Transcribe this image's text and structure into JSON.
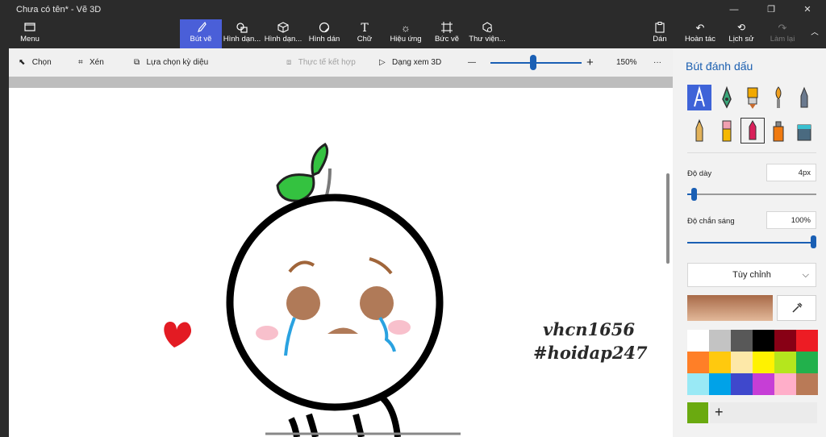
{
  "window": {
    "title": "Chưa có tên* - Vẽ 3D"
  },
  "ribbon": {
    "menu_label": "Menu",
    "tools": [
      {
        "label": "Bút vẽ",
        "icon": "brush-icon",
        "active": true
      },
      {
        "label": "Hình dạn...",
        "icon": "shapes-2d-icon"
      },
      {
        "label": "Hình dạn...",
        "icon": "shapes-3d-icon"
      },
      {
        "label": "Hình dán",
        "icon": "sticker-icon"
      },
      {
        "label": "Chữ",
        "icon": "text-icon"
      },
      {
        "label": "Hiệu ứng",
        "icon": "effects-icon"
      },
      {
        "label": "Bức vẽ",
        "icon": "canvas-icon"
      },
      {
        "label": "Thư viện...",
        "icon": "library-icon"
      }
    ],
    "right_tools": [
      {
        "label": "Dán",
        "icon": "paste-icon"
      },
      {
        "label": "Hoàn tác",
        "icon": "undo-icon"
      },
      {
        "label": "Lịch sử",
        "icon": "history-icon"
      },
      {
        "label": "Làm lại",
        "icon": "redo-icon",
        "disabled": true
      }
    ]
  },
  "subbar": {
    "select": "Chọn",
    "crop": "Xén",
    "magic_select": "Lựa chọn kỳ diệu",
    "mixed_reality": "Thực tế kết hợp",
    "view_3d": "Dạng xem 3D",
    "zoom_minus": "—",
    "zoom_plus": "+",
    "zoom_value": "150%",
    "more": "···"
  },
  "panel": {
    "title": "Bút đánh dấu",
    "brushes": [
      "marker-icon",
      "calligraphy-pen-icon",
      "oil-brush-icon",
      "watercolor-icon",
      "pixel-pen-icon",
      "pencil-icon",
      "eraser-icon",
      "crayon-icon",
      "spray-can-icon",
      "fill-bucket-icon"
    ],
    "thickness_label": "Độ dày",
    "thickness_value": "4px",
    "thickness_level": 0.05,
    "opacity_label": "Độ chắn sáng",
    "opacity_value": "100%",
    "opacity_level": 1.0,
    "dropdown_value": "Tùy chỉnh",
    "current_color": "#b07a58",
    "palette": [
      "#ffffff",
      "#c3c3c3",
      "#585858",
      "#000000",
      "#880015",
      "#ed1c24",
      "#ff7f27",
      "#ffc90e",
      "#fde8a8",
      "#fff200",
      "#b5e61d",
      "#22b14c",
      "#99e9f5",
      "#00a2e8",
      "#3f48cc",
      "#c63ed6",
      "#ffaec9",
      "#b97a57"
    ],
    "custom_color": "#6aaa10",
    "add_label": "+"
  },
  "canvas": {
    "signature_line1": "vhcn1656",
    "signature_line2": "#hoidap247"
  }
}
